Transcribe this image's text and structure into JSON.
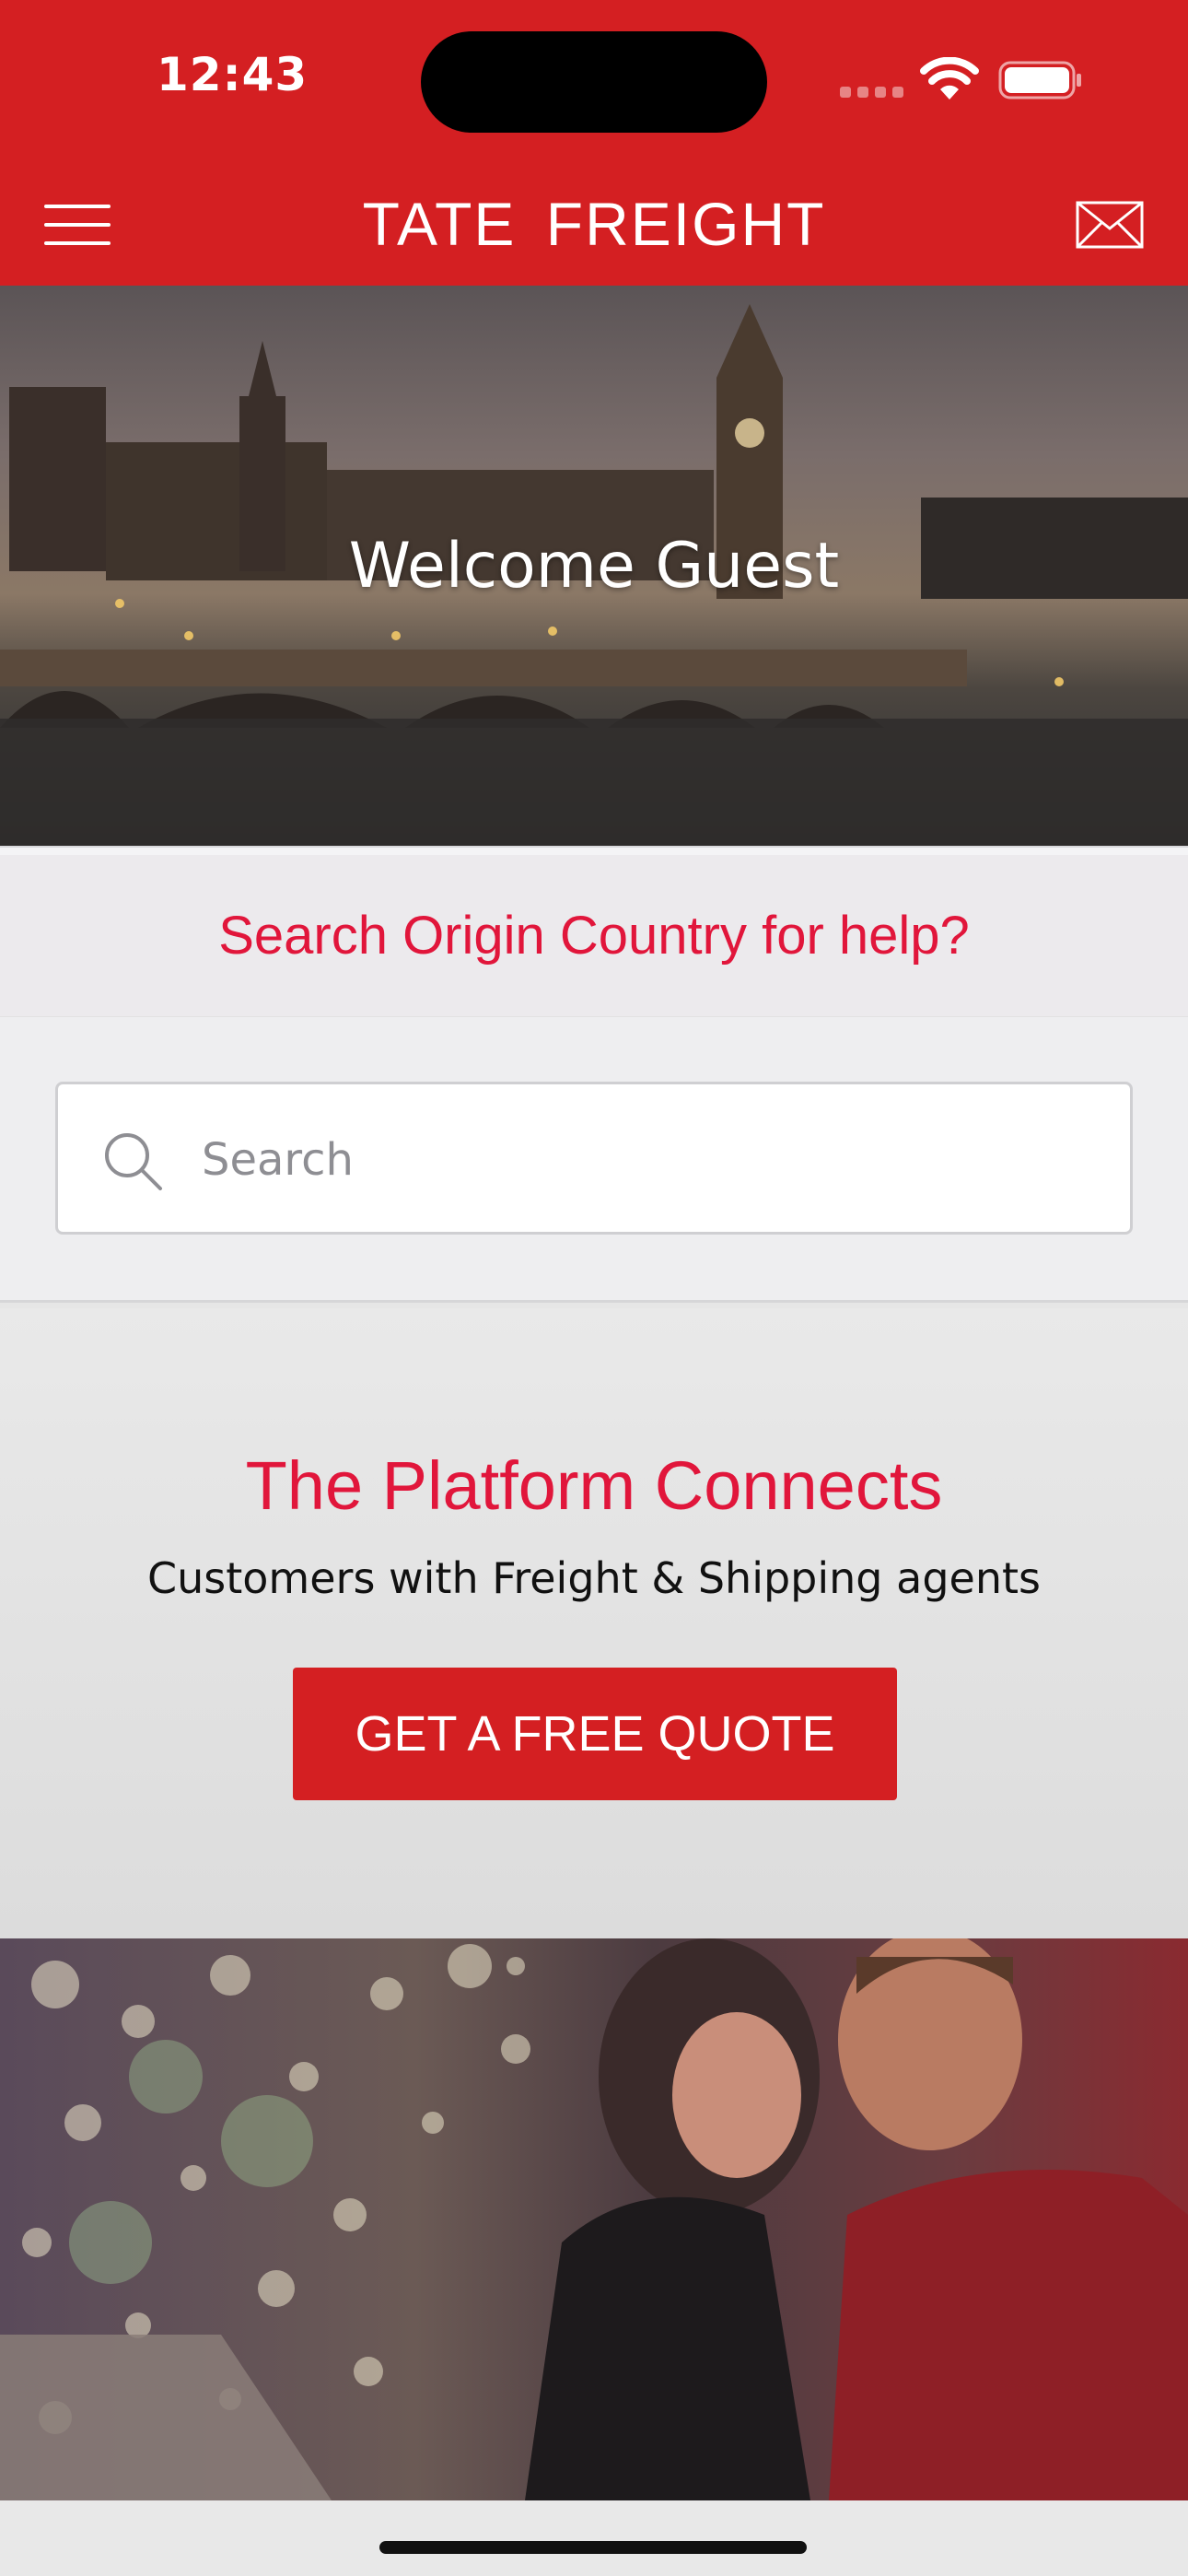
{
  "status_bar": {
    "time": "12:43"
  },
  "app_bar": {
    "title": "TATE  FREIGHT"
  },
  "hero": {
    "title": "Welcome Guest"
  },
  "search": {
    "prompt": "Search Origin Country for help?",
    "placeholder": "Search"
  },
  "promo": {
    "title": "The Platform Connects",
    "subtitle": "Customers with Freight & Shipping agents",
    "cta_label": "GET A FREE QUOTE"
  },
  "colors": {
    "brand_red": "#d41f22",
    "accent_text_red": "#e1163b"
  },
  "icons": {
    "menu": "hamburger-icon",
    "mail": "envelope-icon",
    "search": "magnifier-icon"
  }
}
